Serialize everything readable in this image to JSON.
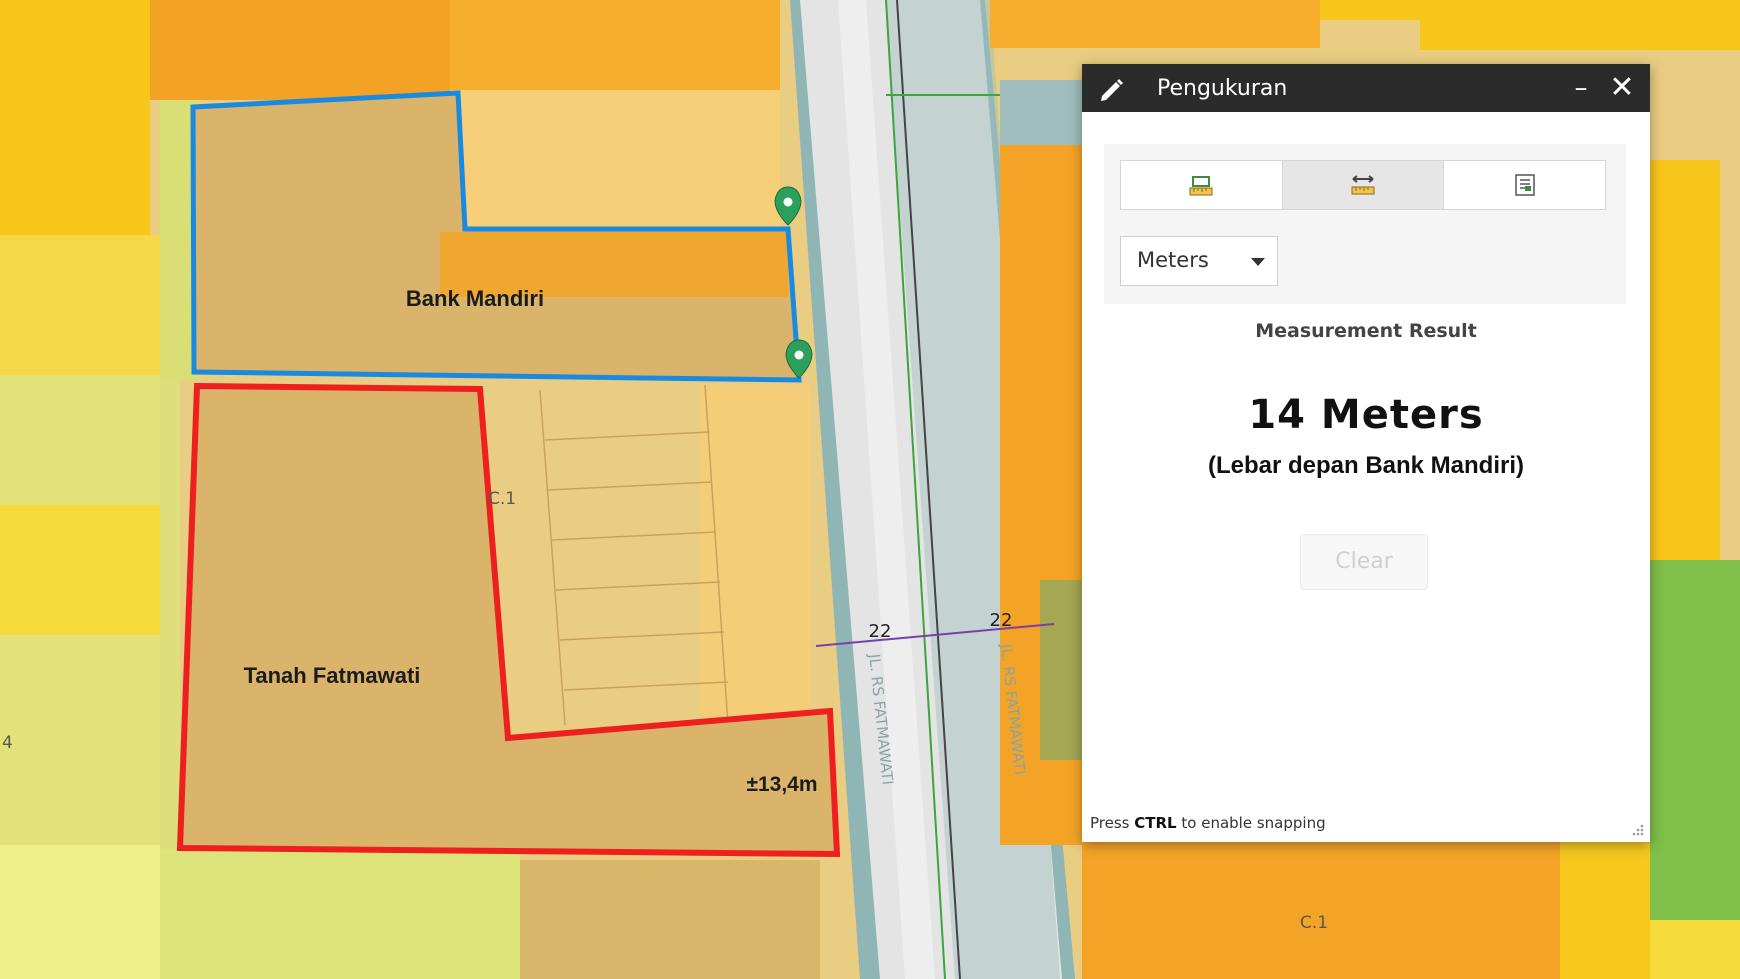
{
  "map": {
    "parcels": {
      "bank_mandiri_label": "Bank Mandiri",
      "tanah_label": "Tanah Fatmawati",
      "frontage_label": "±13,4m",
      "code_c1_left": "C.1",
      "code_c1_bottom": "C.1",
      "code_edge": "4"
    },
    "streets": {
      "name_left": "JL. RS FATMAWATI",
      "name_right": "JL. RS FATMAWATI",
      "width_left": "22",
      "width_right": "22"
    },
    "outline_colors": {
      "bank_mandiri": "#1a8ae0",
      "tanah_fatmawati": "#ee1f1f",
      "pin": "#2aa05a"
    }
  },
  "widget": {
    "title": "Pengukuran",
    "title_icon": "pencil-icon",
    "minimize_icon": "minimize-icon",
    "close_icon": "close-icon",
    "tools": [
      {
        "icon": "area-measure-icon",
        "active": false
      },
      {
        "icon": "distance-measure-icon",
        "active": true
      },
      {
        "icon": "location-measure-icon",
        "active": false
      }
    ],
    "unit_selected": "Meters",
    "result_title": "Measurement Result",
    "result_value": "14 Meters",
    "result_note": "(Lebar depan Bank Mandiri)",
    "clear_label": "Clear",
    "hint_prefix": "Press",
    "hint_key": "CTRL",
    "hint_suffix": "to enable snapping"
  }
}
